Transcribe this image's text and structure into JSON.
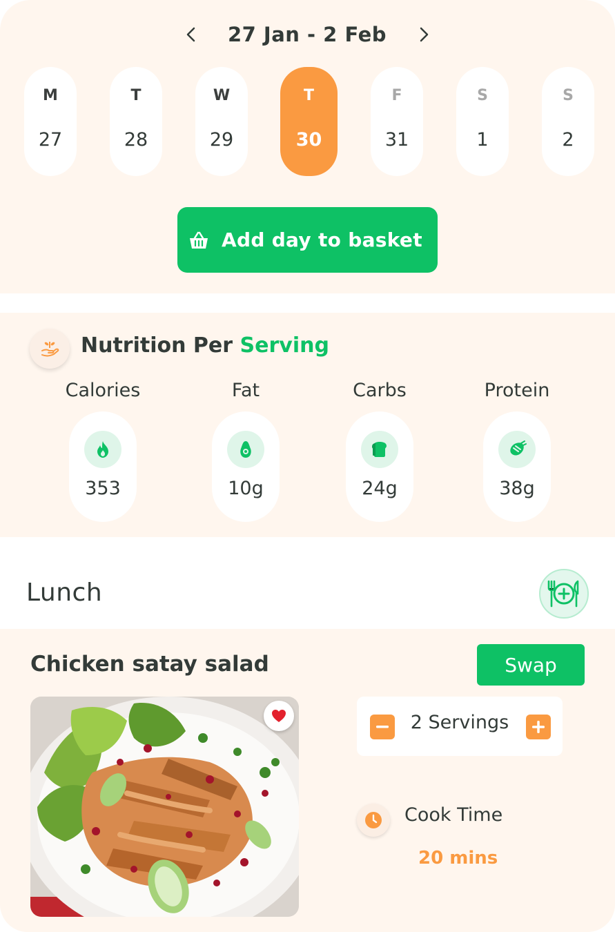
{
  "week": {
    "range": "27  Jan -  2  Feb",
    "prev_icon": "chevron-left-icon",
    "next_icon": "chevron-right-icon",
    "days": [
      {
        "letter": "M",
        "num": "27"
      },
      {
        "letter": "T",
        "num": "28"
      },
      {
        "letter": "W",
        "num": "29"
      },
      {
        "letter": "T",
        "num": "30",
        "selected": true
      },
      {
        "letter": "F",
        "num": "31"
      },
      {
        "letter": "S",
        "num": "1"
      },
      {
        "letter": "S",
        "num": "2"
      }
    ],
    "basket_label": "Add day to basket",
    "basket_icon": "basket-icon"
  },
  "nutrition": {
    "title": "Nutrition Per",
    "title_highlight": "Serving",
    "icon": "hand-plant-icon",
    "macros": [
      {
        "label": "Calories",
        "value": "353",
        "icon": "flame-icon"
      },
      {
        "label": "Fat",
        "value": "10g",
        "icon": "avocado-icon"
      },
      {
        "label": "Carbs",
        "value": "24g",
        "icon": "bread-icon"
      },
      {
        "label": "Protein",
        "value": "38g",
        "icon": "meat-icon"
      }
    ]
  },
  "meal": {
    "title": "Lunch",
    "add_icon": "plate-add-icon"
  },
  "recipe": {
    "name": "Chicken satay salad",
    "swap_label": "Swap",
    "favorite_icon": "heart-icon",
    "servings": "2 Servings",
    "cook_label": "Cook Time",
    "cook_value": "20 mins",
    "cook_icon": "clock-icon"
  },
  "colors": {
    "accent_green": "#0ec165",
    "accent_orange": "#fa9a41",
    "card_bg": "#fff6ee",
    "text": "#333b38"
  }
}
